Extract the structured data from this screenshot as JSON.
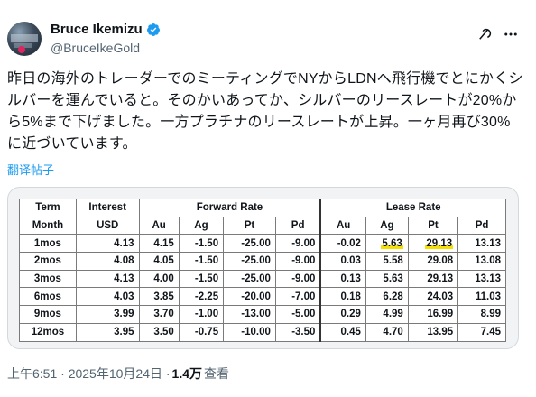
{
  "author": {
    "name": "Bruce Ikemizu",
    "handle": "@BruceIkeGold"
  },
  "tweet": {
    "text": "昨日の海外のトレーダーでのミーティングでNYからLDNへ飛行機でとにかくシルバーを運んでいると。そのかいあってか、シルバーのリースレートが20%から5%まで下げました。一方プラチナのリースレートが上昇。一ヶ月再び30%に近づいています。",
    "translate_label": "翻译帖子"
  },
  "table": {
    "group_headers": [
      "Term",
      "Interest",
      "Forward Rate",
      "Lease Rate"
    ],
    "sub_headers": [
      "Month",
      "USD",
      "Au",
      "Ag",
      "Pt",
      "Pd",
      "Au",
      "Ag",
      "Pt",
      "Pd"
    ],
    "rows": [
      [
        "1mos",
        "4.13",
        "4.15",
        "-1.50",
        "-25.00",
        "-9.00",
        "-0.02",
        "5.63",
        "29.13",
        "13.13"
      ],
      [
        "2mos",
        "4.08",
        "4.05",
        "-1.50",
        "-25.00",
        "-9.00",
        "0.03",
        "5.58",
        "29.08",
        "13.08"
      ],
      [
        "3mos",
        "4.13",
        "4.00",
        "-1.50",
        "-25.00",
        "-9.00",
        "0.13",
        "5.63",
        "29.13",
        "13.13"
      ],
      [
        "6mos",
        "4.03",
        "3.85",
        "-2.25",
        "-20.00",
        "-7.00",
        "0.18",
        "6.28",
        "24.03",
        "11.03"
      ],
      [
        "9mos",
        "3.99",
        "3.70",
        "-1.00",
        "-13.00",
        "-5.00",
        "0.29",
        "4.99",
        "16.99",
        "8.99"
      ],
      [
        "12mos",
        "3.95",
        "3.50",
        "-0.75",
        "-10.00",
        "-3.50",
        "0.45",
        "4.70",
        "13.95",
        "7.45"
      ]
    ],
    "highlight_color": "#f5ea3a"
  },
  "meta": {
    "time": "上午6:51 · 2025年10月24日 · ",
    "views_count": "1.4万",
    "views_label": " 查看"
  },
  "colors": {
    "link": "#1d9bf0",
    "muted": "#536471",
    "verified": "#1d9bf0"
  }
}
